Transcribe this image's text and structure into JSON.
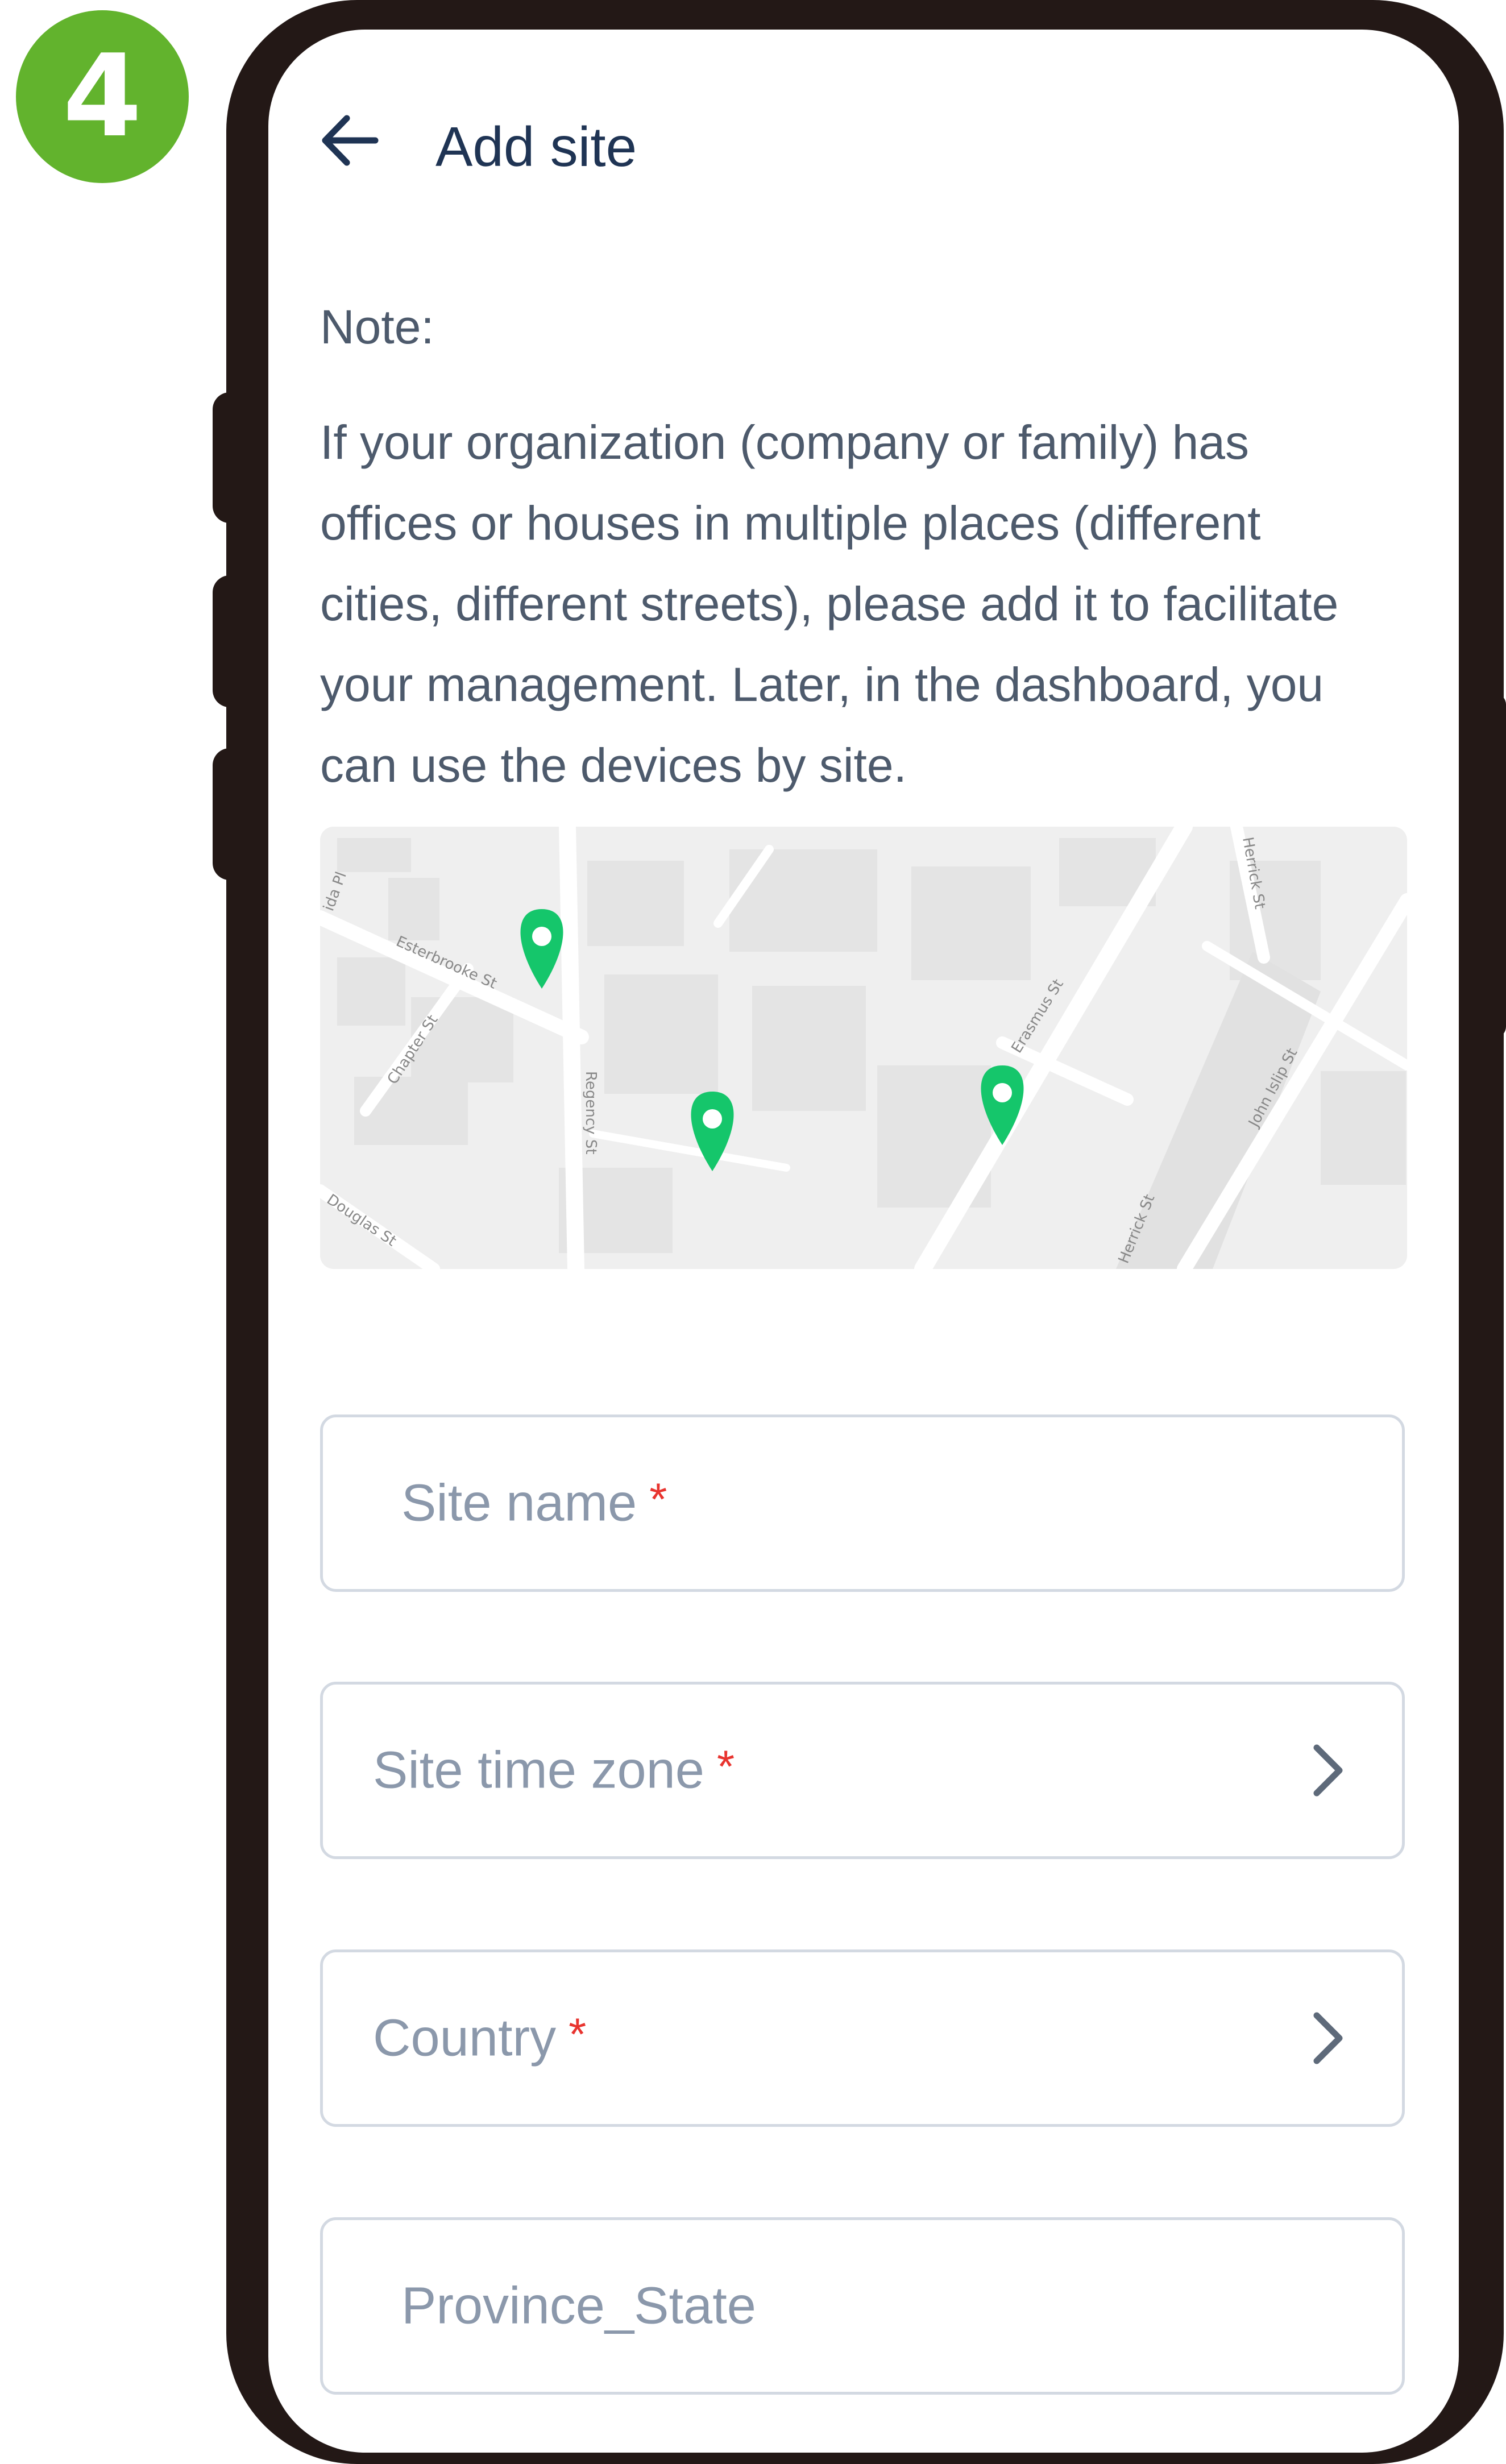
{
  "step_badge": "4",
  "header": {
    "title": "Add site",
    "back_icon": "arrow-left-icon"
  },
  "note": {
    "label": "Note:",
    "lines": [
      "If your organization (company or family) has",
      "offices or houses in multiple places (different",
      "cities, different streets), please add it to facilitate",
      "your management. Later, in the dashboard, you",
      "can use the devices by site."
    ]
  },
  "map": {
    "streets": [
      "Esterbrooke St",
      "Chapter St",
      "Regency St",
      "Douglas St",
      "Herrick St",
      "John Islip St",
      "Erasmus St",
      "ida Pl"
    ],
    "pin_color": "#15c66b",
    "pin_icon": "map-pin-icon",
    "pin_count": 3
  },
  "form": {
    "site_name": {
      "label": "Site name",
      "required_mark": "*"
    },
    "time_zone": {
      "label": "Site time zone",
      "required_mark": "*",
      "icon": "chevron-right-icon"
    },
    "country": {
      "label": "Country",
      "required_mark": "*",
      "icon": "chevron-right-icon"
    },
    "province": {
      "label": "Province_State"
    }
  },
  "colors": {
    "accent_green": "#62b32d",
    "phone_frame": "#231816",
    "required": "#e8342f",
    "title_text": "#1f3454",
    "body_text": "#4d5a6c"
  }
}
